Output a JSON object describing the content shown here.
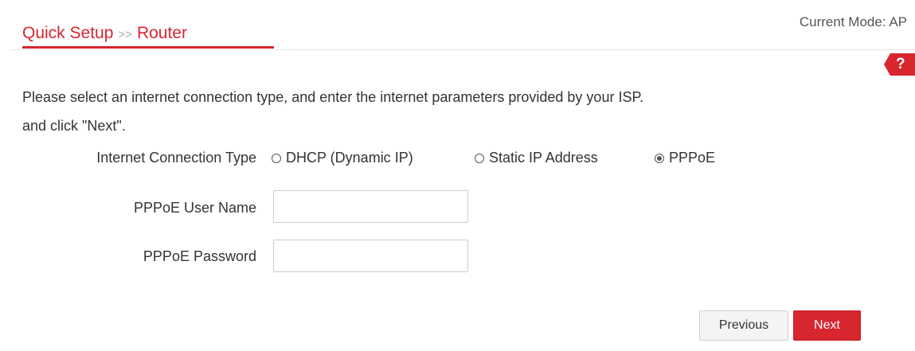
{
  "header": {
    "breadcrumb_root": "Quick Setup",
    "breadcrumb_separator": ">>",
    "breadcrumb_current": "Router",
    "current_mode": "Current Mode: AP",
    "help_label": "?"
  },
  "intro": {
    "line1": "Please select an internet connection type, and enter the internet parameters provided by your ISP.",
    "line2": "and click \"Next\"."
  },
  "connection_type": {
    "label": "Internet Connection Type",
    "options": [
      {
        "label": "DHCP (Dynamic IP)",
        "checked": false
      },
      {
        "label": "Static IP Address",
        "checked": false
      },
      {
        "label": "PPPoE",
        "checked": true
      }
    ]
  },
  "pppoe": {
    "username_label": "PPPoE User Name",
    "username_value": "",
    "password_label": "PPPoE Password",
    "password_value": ""
  },
  "buttons": {
    "previous": "Previous",
    "next": "Next"
  },
  "colors": {
    "accent": "#d8262f",
    "text": "#333333",
    "border": "#cccccc"
  }
}
